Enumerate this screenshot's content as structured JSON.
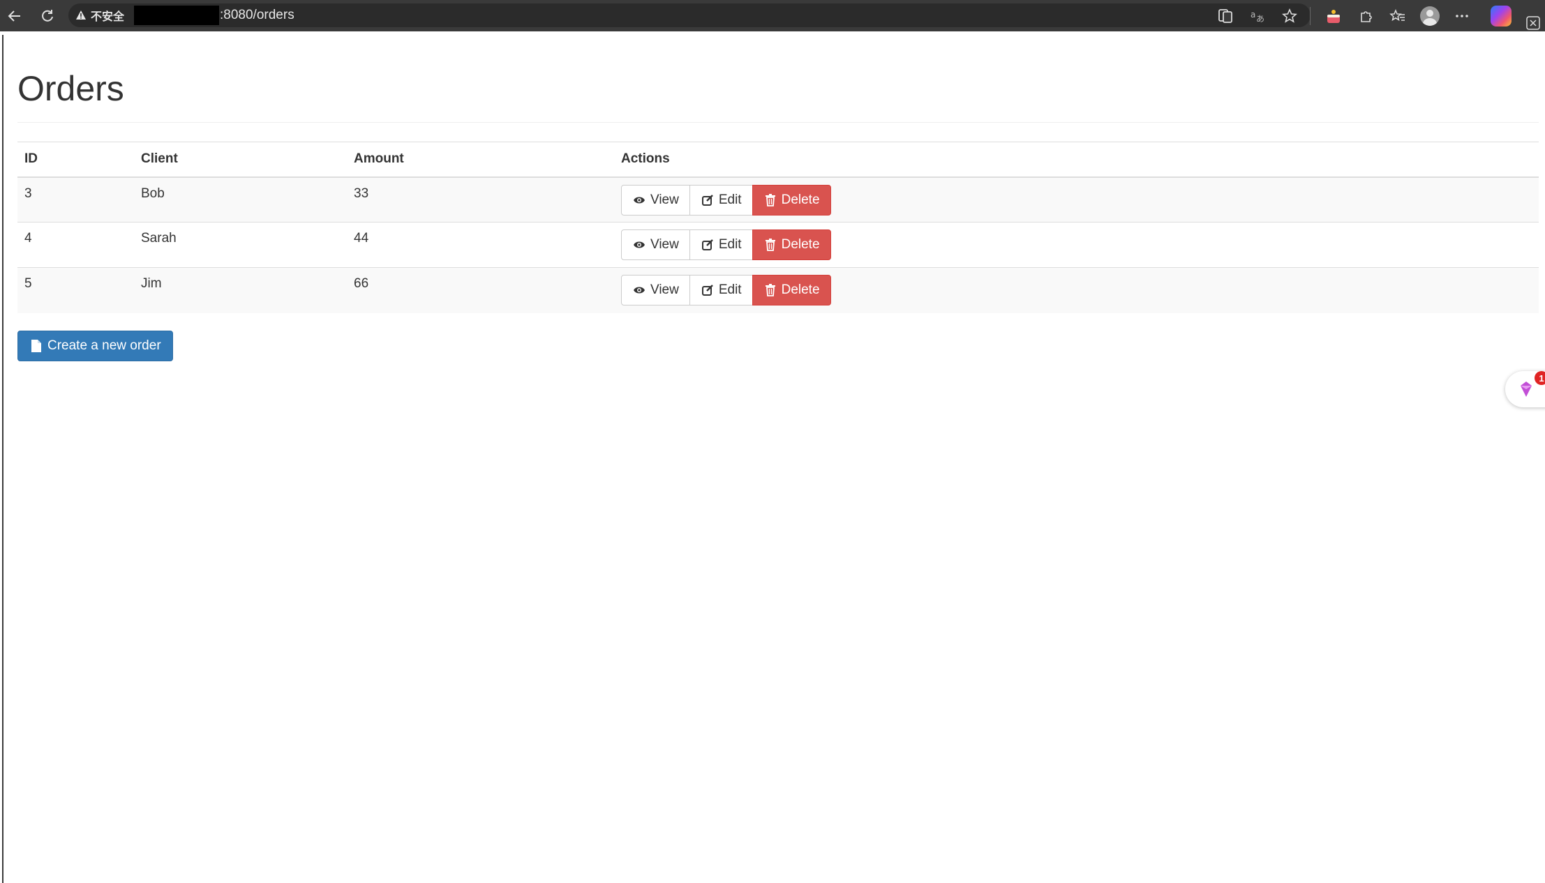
{
  "browser": {
    "security_label": "不安全",
    "url_path": ":8080/orders"
  },
  "page": {
    "title": "Orders"
  },
  "table": {
    "headers": [
      "ID",
      "Client",
      "Amount",
      "Actions"
    ],
    "rows": [
      {
        "id": "3",
        "client": "Bob",
        "amount": "33"
      },
      {
        "id": "4",
        "client": "Sarah",
        "amount": "44"
      },
      {
        "id": "5",
        "client": "Jim",
        "amount": "66"
      }
    ],
    "actions": {
      "view_label": "View",
      "edit_label": "Edit",
      "delete_label": "Delete"
    }
  },
  "create_button": {
    "label": "Create a new order"
  },
  "side_widget": {
    "badge_count": "1"
  },
  "colors": {
    "primary": "#337ab7",
    "danger": "#d9534f",
    "chrome": "#3a3a3a"
  }
}
